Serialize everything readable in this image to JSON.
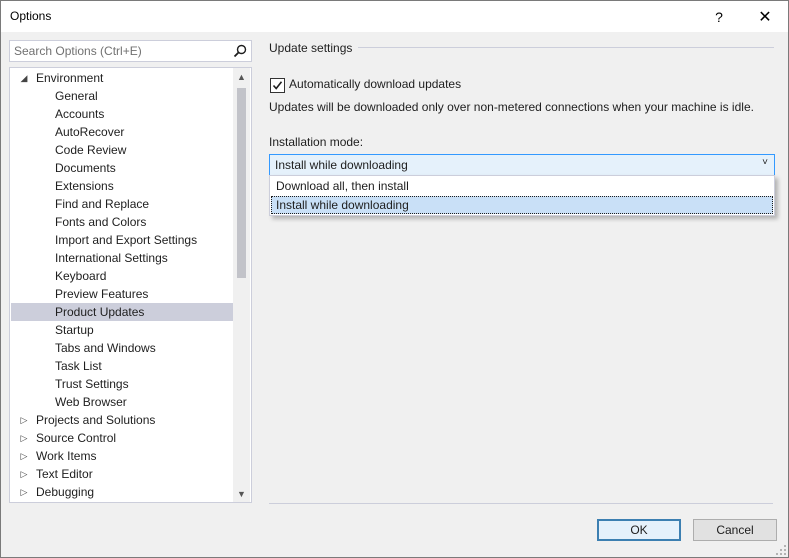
{
  "window": {
    "title": "Options",
    "help_label": "?",
    "close_label": "✕"
  },
  "search": {
    "placeholder": "Search Options (Ctrl+E)",
    "icon": "search-icon"
  },
  "tree": {
    "items": [
      {
        "label": "Environment",
        "level": 0,
        "state": "expanded"
      },
      {
        "label": "General",
        "level": 1
      },
      {
        "label": "Accounts",
        "level": 1
      },
      {
        "label": "AutoRecover",
        "level": 1
      },
      {
        "label": "Code Review",
        "level": 1
      },
      {
        "label": "Documents",
        "level": 1
      },
      {
        "label": "Extensions",
        "level": 1
      },
      {
        "label": "Find and Replace",
        "level": 1
      },
      {
        "label": "Fonts and Colors",
        "level": 1
      },
      {
        "label": "Import and Export Settings",
        "level": 1
      },
      {
        "label": "International Settings",
        "level": 1
      },
      {
        "label": "Keyboard",
        "level": 1
      },
      {
        "label": "Preview Features",
        "level": 1
      },
      {
        "label": "Product Updates",
        "level": 1,
        "selected": true
      },
      {
        "label": "Startup",
        "level": 1
      },
      {
        "label": "Tabs and Windows",
        "level": 1
      },
      {
        "label": "Task List",
        "level": 1
      },
      {
        "label": "Trust Settings",
        "level": 1
      },
      {
        "label": "Web Browser",
        "level": 1
      },
      {
        "label": "Projects and Solutions",
        "level": 0,
        "state": "collapsed"
      },
      {
        "label": "Source Control",
        "level": 0,
        "state": "collapsed"
      },
      {
        "label": "Work Items",
        "level": 0,
        "state": "collapsed"
      },
      {
        "label": "Text Editor",
        "level": 0,
        "state": "collapsed"
      },
      {
        "label": "Debugging",
        "level": 0,
        "state": "collapsed"
      }
    ]
  },
  "settings": {
    "section_title": "Update settings",
    "auto_download_label": "Automatically download updates",
    "auto_download_checked": true,
    "info_text": "Updates will be downloaded only over non-metered connections when your machine is idle.",
    "mode_label": "Installation mode:",
    "mode_value": "Install while downloading",
    "mode_options": [
      "Download all, then install",
      "Install while downloading"
    ]
  },
  "buttons": {
    "ok": "OK",
    "cancel": "Cancel"
  },
  "colors": {
    "selection": "#cccedb",
    "focus": "#3399ff",
    "accent": "#3c7fb1"
  }
}
